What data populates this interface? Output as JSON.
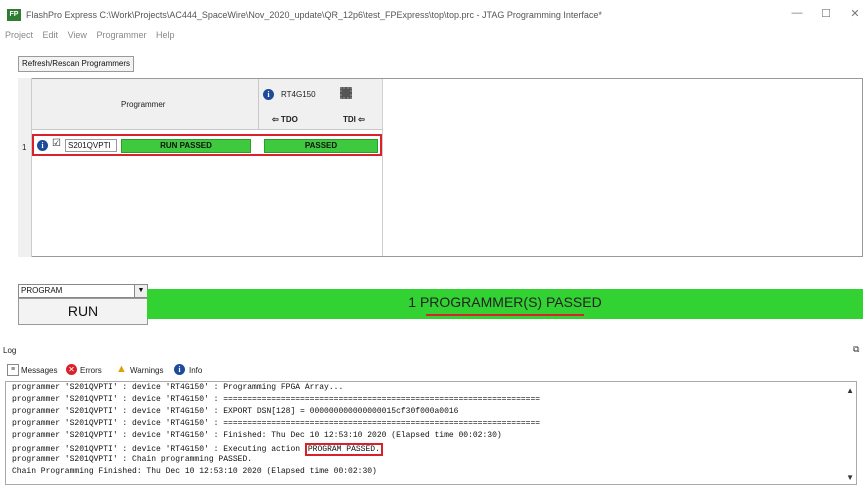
{
  "titlebar": {
    "app_icon": "FP",
    "title": "FlashPro Express  C:\\Work\\Projects\\AC444_SpaceWire\\Nov_2020_update\\QR_12p6\\test_FPExpress\\top\\top.prc  - JTAG Programming Interface*",
    "minimize": "—",
    "maximize": "☐",
    "close": "✕"
  },
  "menu": [
    "Project",
    "Edit",
    "View",
    "Programmer",
    "Help"
  ],
  "toolbar": {
    "refresh_label": "Refresh/Rescan Programmers"
  },
  "grid": {
    "programmer_header": "Programmer",
    "device_name": "RT4G150",
    "tdo_label": "⇦ TDO",
    "tdi_label": "TDI ⇦",
    "row": {
      "index": "1",
      "info": "i",
      "checkbox": "☑",
      "programmer_id": "S201QVPTI",
      "run_status": "RUN PASSED",
      "device_status": "PASSED"
    }
  },
  "action": {
    "selected": "PROGRAM",
    "run_label": "RUN",
    "status": "1 PROGRAMMER(S) PASSED"
  },
  "log": {
    "title": "Log",
    "tabs": [
      "Messages",
      "Errors",
      "Warnings",
      "Info"
    ],
    "lines": [
      "programmer 'S201QVPTI' : device 'RT4G150' : Programming FPGA Array...",
      "programmer 'S201QVPTI' : device 'RT4G150' : ==================================================================",
      "programmer 'S201QVPTI' : device 'RT4G150' : EXPORT DSN[128] = 000000000000000015cf30f000a0016",
      "programmer 'S201QVPTI' : device 'RT4G150' : ==================================================================",
      "programmer 'S201QVPTI' : device 'RT4G150' : Finished: Thu Dec 10 12:53:10 2020 (Elapsed time 00:02:30)",
      "programmer 'S201QVPTI' : device 'RT4G150' : Executing action ",
      "programmer 'S201QVPTI' : Chain programming PASSED.",
      "Chain Programming Finished: Thu Dec 10 12:53:10 2020 (Elapsed time 00:02:30)"
    ],
    "highlight": "PROGRAM PASSED."
  }
}
